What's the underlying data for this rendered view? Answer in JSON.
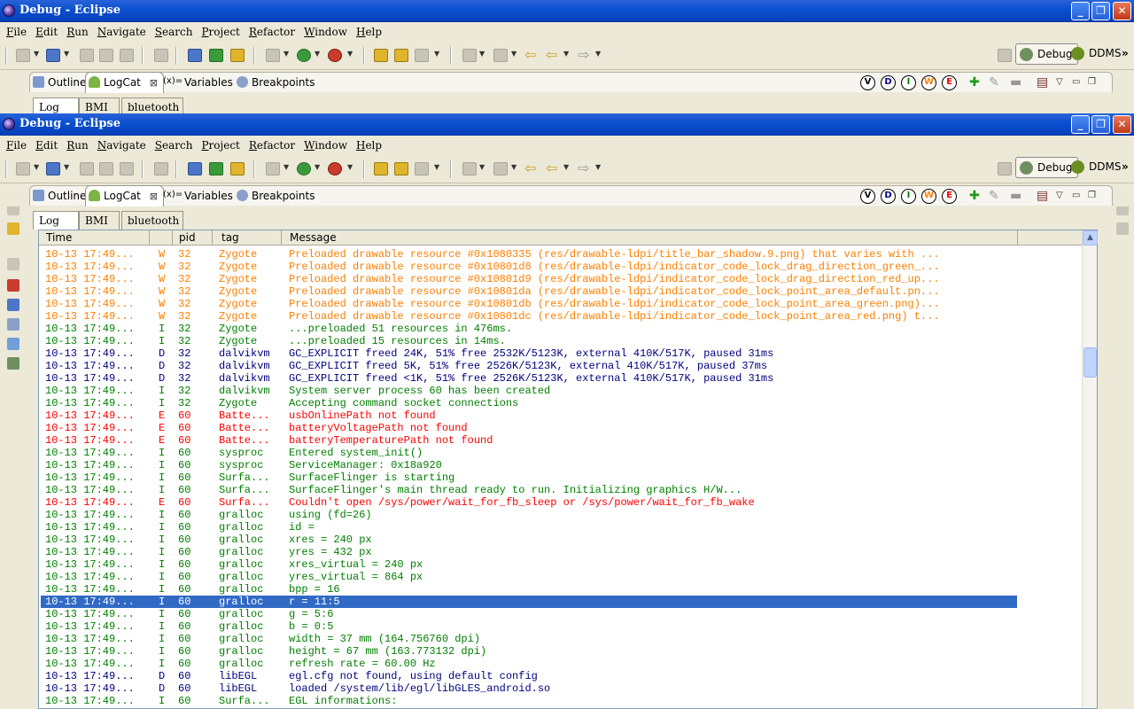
{
  "window": {
    "title": "Debug - Eclipse",
    "controls": {
      "minimize": "_",
      "maximize": "❐",
      "close": "✕"
    }
  },
  "menu": [
    "File",
    "Edit",
    "Run",
    "Navigate",
    "Search",
    "Project",
    "Refactor",
    "Window",
    "Help"
  ],
  "perspectives": {
    "active": "Debug",
    "other": "DDMS",
    "overflow": "»"
  },
  "view_tabs": [
    {
      "label": "Outline",
      "icon": "outline-icon"
    },
    {
      "label": "LogCat",
      "icon": "android-icon",
      "active": true,
      "close": "⊠"
    },
    {
      "label": "Variables",
      "icon": "variables-icon",
      "glyph": "(x)="
    },
    {
      "label": "Breakpoints",
      "icon": "breakpoints-icon"
    }
  ],
  "log_levels": [
    "V",
    "D",
    "I",
    "W",
    "E"
  ],
  "log_level_colors": {
    "V": "#000000",
    "D": "#00007f",
    "I": "#007f00",
    "W": "#ff7f00",
    "E": "#ff0000"
  },
  "subtabs": [
    "Log",
    "BMI",
    "bluetooth"
  ],
  "columns": {
    "time": "Time",
    "pid": "pid",
    "tag": "tag",
    "message": "Message"
  },
  "log_rows": [
    {
      "time": "10-13 17:49...",
      "level": "W",
      "pid": "32",
      "tag": "Zygote",
      "message": "Preloaded drawable resource #0x1080335 (res/drawable-ldpi/title_bar_shadow.9.png) that varies with ..."
    },
    {
      "time": "10-13 17:49...",
      "level": "W",
      "pid": "32",
      "tag": "Zygote",
      "message": "Preloaded drawable resource #0x10801d8 (res/drawable-ldpi/indicator_code_lock_drag_direction_green_..."
    },
    {
      "time": "10-13 17:49...",
      "level": "W",
      "pid": "32",
      "tag": "Zygote",
      "message": "Preloaded drawable resource #0x10801d9 (res/drawable-ldpi/indicator_code_lock_drag_direction_red_up..."
    },
    {
      "time": "10-13 17:49...",
      "level": "W",
      "pid": "32",
      "tag": "Zygote",
      "message": "Preloaded drawable resource #0x10801da (res/drawable-ldpi/indicator_code_lock_point_area_default.pn..."
    },
    {
      "time": "10-13 17:49...",
      "level": "W",
      "pid": "32",
      "tag": "Zygote",
      "message": "Preloaded drawable resource #0x10801db (res/drawable-ldpi/indicator_code_lock_point_area_green.png)..."
    },
    {
      "time": "10-13 17:49...",
      "level": "W",
      "pid": "32",
      "tag": "Zygote",
      "message": "Preloaded drawable resource #0x10801dc (res/drawable-ldpi/indicator_code_lock_point_area_red.png) t..."
    },
    {
      "time": "10-13 17:49...",
      "level": "I",
      "pid": "32",
      "tag": "Zygote",
      "message": "...preloaded 51 resources in 476ms."
    },
    {
      "time": "10-13 17:49...",
      "level": "I",
      "pid": "32",
      "tag": "Zygote",
      "message": "...preloaded 15 resources in 14ms."
    },
    {
      "time": "10-13 17:49...",
      "level": "D",
      "pid": "32",
      "tag": "dalvikvm",
      "message": "GC_EXPLICIT freed 24K, 51% free 2532K/5123K, external 410K/517K, paused 31ms"
    },
    {
      "time": "10-13 17:49...",
      "level": "D",
      "pid": "32",
      "tag": "dalvikvm",
      "message": "GC_EXPLICIT freed 5K, 51% free 2526K/5123K, external 410K/517K, paused 37ms"
    },
    {
      "time": "10-13 17:49...",
      "level": "D",
      "pid": "32",
      "tag": "dalvikvm",
      "message": "GC_EXPLICIT freed <1K, 51% free 2526K/5123K, external 410K/517K, paused 31ms"
    },
    {
      "time": "10-13 17:49...",
      "level": "I",
      "pid": "32",
      "tag": "dalvikvm",
      "message": "System server process 60 has been created"
    },
    {
      "time": "10-13 17:49...",
      "level": "I",
      "pid": "32",
      "tag": "Zygote",
      "message": "Accepting command socket connections"
    },
    {
      "time": "10-13 17:49...",
      "level": "E",
      "pid": "60",
      "tag": "Batte...",
      "message": "usbOnlinePath not found"
    },
    {
      "time": "10-13 17:49...",
      "level": "E",
      "pid": "60",
      "tag": "Batte...",
      "message": "batteryVoltagePath not found"
    },
    {
      "time": "10-13 17:49...",
      "level": "E",
      "pid": "60",
      "tag": "Batte...",
      "message": "batteryTemperaturePath not found"
    },
    {
      "time": "10-13 17:49...",
      "level": "I",
      "pid": "60",
      "tag": "sysproc",
      "message": "Entered system_init()"
    },
    {
      "time": "10-13 17:49...",
      "level": "I",
      "pid": "60",
      "tag": "sysproc",
      "message": "ServiceManager: 0x18a920"
    },
    {
      "time": "10-13 17:49...",
      "level": "I",
      "pid": "60",
      "tag": "Surfa...",
      "message": "SurfaceFlinger is starting"
    },
    {
      "time": "10-13 17:49...",
      "level": "I",
      "pid": "60",
      "tag": "Surfa...",
      "message": "SurfaceFlinger's main thread ready to run. Initializing graphics H/W..."
    },
    {
      "time": "10-13 17:49...",
      "level": "E",
      "pid": "60",
      "tag": "Surfa...",
      "message": "Couldn't open /sys/power/wait_for_fb_sleep or /sys/power/wait_for_fb_wake"
    },
    {
      "time": "10-13 17:49...",
      "level": "I",
      "pid": "60",
      "tag": "gralloc",
      "message": "using (fd=26)"
    },
    {
      "time": "10-13 17:49...",
      "level": "I",
      "pid": "60",
      "tag": "gralloc",
      "message": "id           ="
    },
    {
      "time": "10-13 17:49...",
      "level": "I",
      "pid": "60",
      "tag": "gralloc",
      "message": "xres         = 240 px"
    },
    {
      "time": "10-13 17:49...",
      "level": "I",
      "pid": "60",
      "tag": "gralloc",
      "message": "yres         = 432 px"
    },
    {
      "time": "10-13 17:49...",
      "level": "I",
      "pid": "60",
      "tag": "gralloc",
      "message": "xres_virtual = 240 px"
    },
    {
      "time": "10-13 17:49...",
      "level": "I",
      "pid": "60",
      "tag": "gralloc",
      "message": "yres_virtual = 864 px"
    },
    {
      "time": "10-13 17:49...",
      "level": "I",
      "pid": "60",
      "tag": "gralloc",
      "message": "bpp          = 16"
    },
    {
      "time": "10-13 17:49...",
      "level": "I",
      "pid": "60",
      "tag": "gralloc",
      "message": "r            = 11:5",
      "selected": true
    },
    {
      "time": "10-13 17:49...",
      "level": "I",
      "pid": "60",
      "tag": "gralloc",
      "message": "g            =  5:6"
    },
    {
      "time": "10-13 17:49...",
      "level": "I",
      "pid": "60",
      "tag": "gralloc",
      "message": "b            =  0:5"
    },
    {
      "time": "10-13 17:49...",
      "level": "I",
      "pid": "60",
      "tag": "gralloc",
      "message": "width        = 37 mm (164.756760 dpi)"
    },
    {
      "time": "10-13 17:49...",
      "level": "I",
      "pid": "60",
      "tag": "gralloc",
      "message": "height       = 67 mm (163.773132 dpi)"
    },
    {
      "time": "10-13 17:49...",
      "level": "I",
      "pid": "60",
      "tag": "gralloc",
      "message": "refresh rate = 60.00 Hz"
    },
    {
      "time": "10-13 17:49...",
      "level": "D",
      "pid": "60",
      "tag": "libEGL",
      "message": "egl.cfg not found, using default config"
    },
    {
      "time": "10-13 17:49...",
      "level": "D",
      "pid": "60",
      "tag": "libEGL",
      "message": "loaded /system/lib/egl/libGLES_android.so"
    },
    {
      "time": "10-13 17:49...",
      "level": "I",
      "pid": "60",
      "tag": "Surfa...",
      "message": "EGL informations:"
    }
  ]
}
